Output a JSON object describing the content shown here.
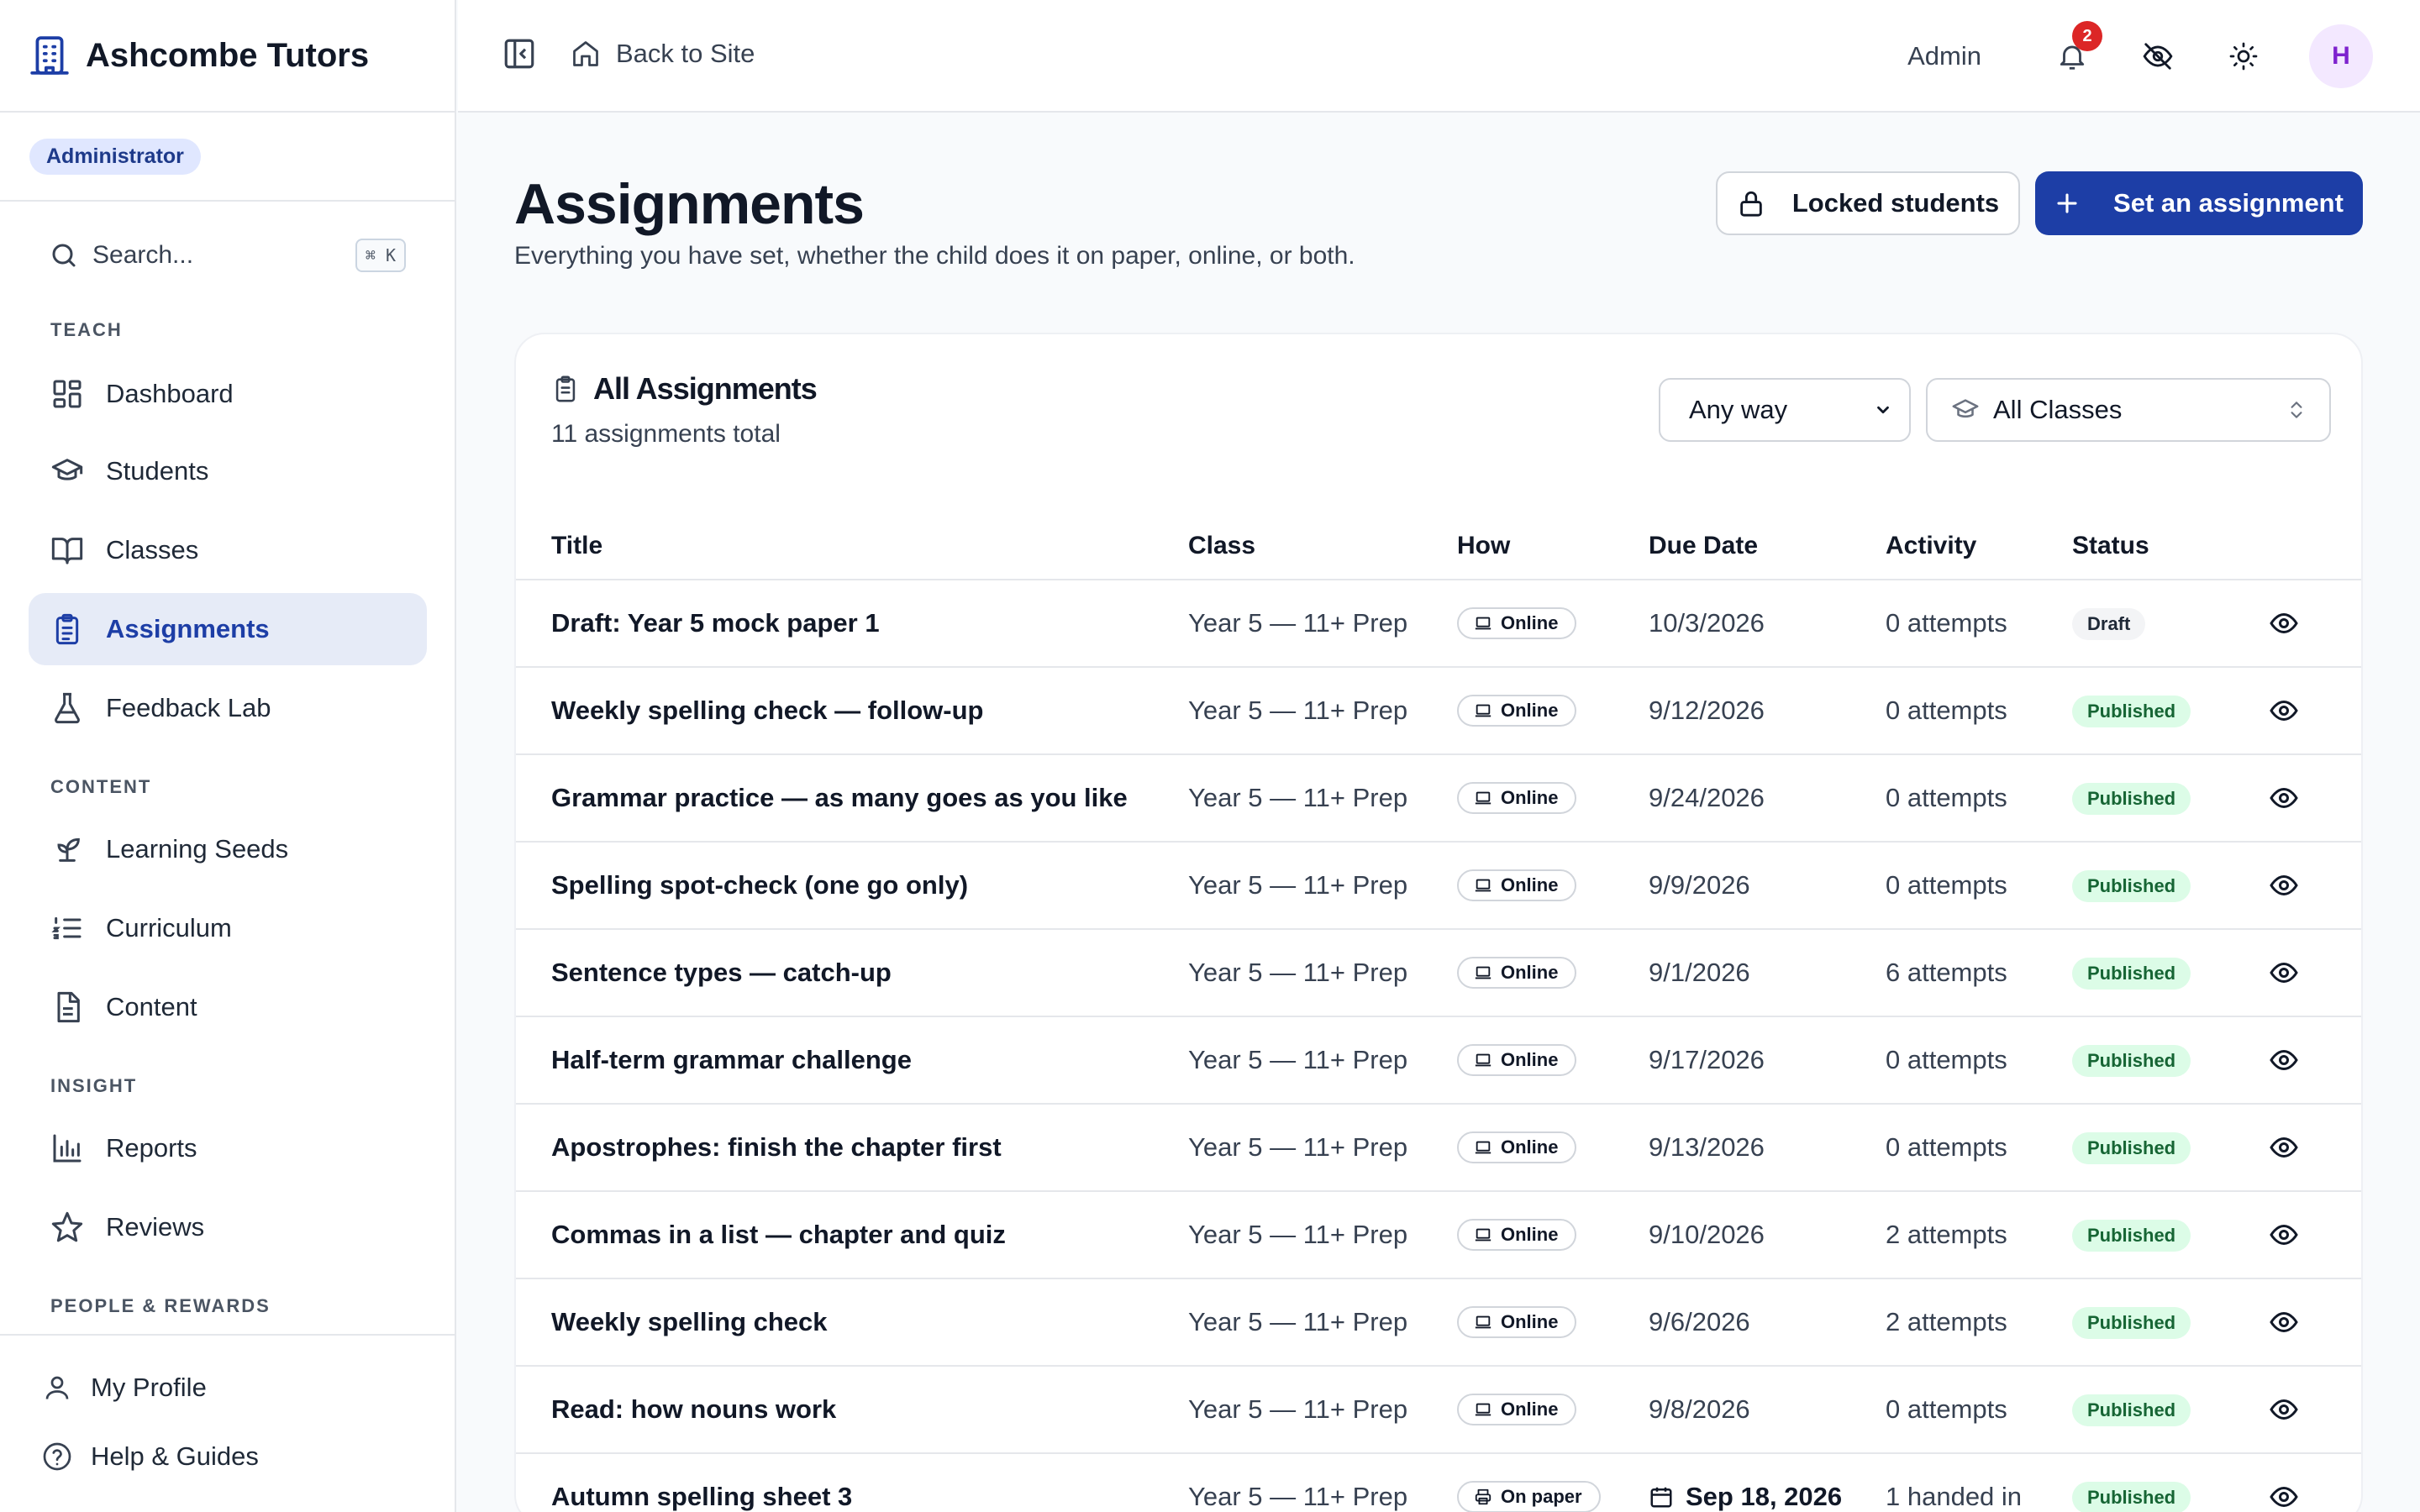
{
  "app": {
    "name": "Ashcombe Tutors",
    "role": "Administrator"
  },
  "sidebar": {
    "search_placeholder": "Search...",
    "search_shortcut": "⌘ K",
    "sections": {
      "teach": "TEACH",
      "content": "CONTENT",
      "insight": "INSIGHT",
      "people": "PEOPLE & REWARDS"
    },
    "items": {
      "dashboard": "Dashboard",
      "students": "Students",
      "classes": "Classes",
      "assignments": "Assignments",
      "feedback_lab": "Feedback Lab",
      "learning_seeds": "Learning Seeds",
      "curriculum": "Curriculum",
      "content": "Content",
      "reports": "Reports",
      "reviews": "Reviews"
    },
    "bottom": {
      "profile": "My Profile",
      "help": "Help & Guides"
    }
  },
  "topbar": {
    "back_label": "Back to Site",
    "user_label": "Admin",
    "notification_count": "2",
    "avatar_initial": "H"
  },
  "page": {
    "title": "Assignments",
    "subtitle": "Everything you have set, whether the child does it on paper, online, or both.",
    "locked_button": "Locked students",
    "set_button": "Set an assignment"
  },
  "card": {
    "title": "All Assignments",
    "subtitle": "11 assignments total",
    "filter_mode": "Any way",
    "filter_class": "All Classes"
  },
  "table": {
    "headers": {
      "title": "Title",
      "class": "Class",
      "how": "How",
      "due": "Due Date",
      "activity": "Activity",
      "status": "Status"
    },
    "rows": [
      {
        "title": "Draft: Year 5 mock paper 1",
        "class": "Year 5 — 11+ Prep",
        "how": "Online",
        "due": "10/3/2026",
        "activity": "0 attempts",
        "status": "Draft"
      },
      {
        "title": "Weekly spelling check — follow-up",
        "class": "Year 5 — 11+ Prep",
        "how": "Online",
        "due": "9/12/2026",
        "activity": "0 attempts",
        "status": "Published"
      },
      {
        "title": "Grammar practice — as many goes as you like",
        "class": "Year 5 — 11+ Prep",
        "how": "Online",
        "due": "9/24/2026",
        "activity": "0 attempts",
        "status": "Published"
      },
      {
        "title": "Spelling spot-check (one go only)",
        "class": "Year 5 — 11+ Prep",
        "how": "Online",
        "due": "9/9/2026",
        "activity": "0 attempts",
        "status": "Published"
      },
      {
        "title": "Sentence types — catch-up",
        "class": "Year 5 — 11+ Prep",
        "how": "Online",
        "due": "9/1/2026",
        "activity": "6 attempts",
        "status": "Published"
      },
      {
        "title": "Half-term grammar challenge",
        "class": "Year 5 — 11+ Prep",
        "how": "Online",
        "due": "9/17/2026",
        "activity": "0 attempts",
        "status": "Published"
      },
      {
        "title": "Apostrophes: finish the chapter first",
        "class": "Year 5 — 11+ Prep",
        "how": "Online",
        "due": "9/13/2026",
        "activity": "0 attempts",
        "status": "Published"
      },
      {
        "title": "Commas in a list — chapter and quiz",
        "class": "Year 5 — 11+ Prep",
        "how": "Online",
        "due": "9/10/2026",
        "activity": "2 attempts",
        "status": "Published"
      },
      {
        "title": "Weekly spelling check",
        "class": "Year 5 — 11+ Prep",
        "how": "Online",
        "due": "9/6/2026",
        "activity": "2 attempts",
        "status": "Published"
      },
      {
        "title": "Read: how nouns work",
        "class": "Year 5 — 11+ Prep",
        "how": "Online",
        "due": "9/8/2026",
        "activity": "0 attempts",
        "status": "Published"
      },
      {
        "title": "Autumn spelling sheet 3",
        "class": "Year 5 — 11+ Prep",
        "how": "On paper",
        "due": "Sep 18, 2026",
        "activity": "1 handed in",
        "status": "Published"
      }
    ]
  },
  "colors": {
    "accent": "#1d3ea6",
    "published_bg": "#dcfce7",
    "published_text": "#166534",
    "badge": "#dc2626"
  }
}
